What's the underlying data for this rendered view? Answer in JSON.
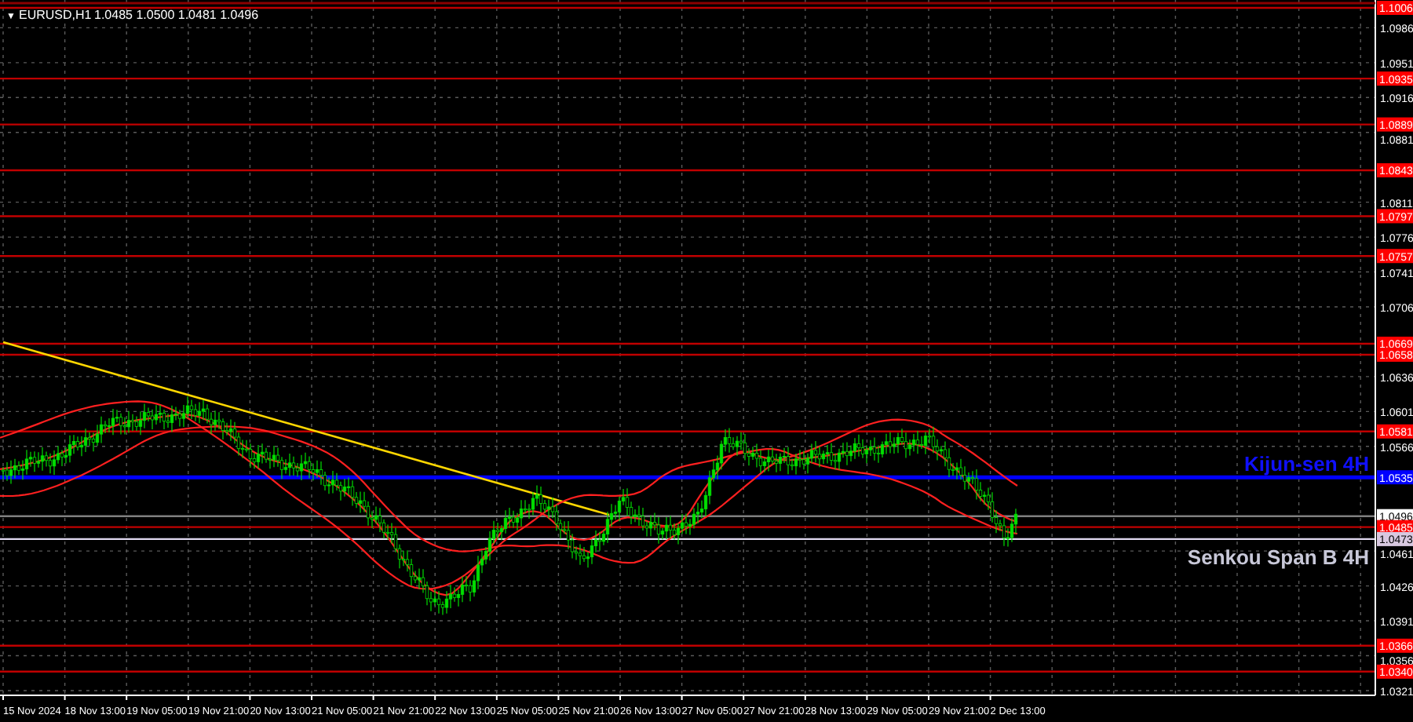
{
  "chart": {
    "marker": "▼",
    "symbol": "EURUSD,H1",
    "ohlc": "1.0485 1.0500 1.0481 1.0496"
  },
  "price_axis": {
    "ticks": [
      "1.0986",
      "1.0951",
      "1.0916",
      "1.0881",
      "1.0811",
      "1.0776",
      "1.0741",
      "1.0706",
      "1.0636",
      "1.0601",
      "1.0566",
      "1.0461",
      "1.0426",
      "1.0391",
      "1.0356",
      "1.0321"
    ]
  },
  "levels": [
    {
      "price": "1.1006",
      "kind": "level"
    },
    {
      "price": "1.0935",
      "kind": "level"
    },
    {
      "price": "1.0889",
      "kind": "level"
    },
    {
      "price": "1.0843",
      "kind": "level"
    },
    {
      "price": "1.0797",
      "kind": "level"
    },
    {
      "price": "1.0757",
      "kind": "level"
    },
    {
      "price": "1.0669",
      "kind": "level"
    },
    {
      "price": "1.0658",
      "kind": "level"
    },
    {
      "price": "1.0581",
      "kind": "level"
    },
    {
      "price": "1.0535",
      "kind": "kijun",
      "caption": "Kijun-sen 4H"
    },
    {
      "price": "1.0496",
      "kind": "current"
    },
    {
      "price": "1.0485",
      "kind": "level"
    },
    {
      "price": "1.0473",
      "kind": "senkou",
      "caption": "Senkou Span B 4H"
    },
    {
      "price": "1.0366",
      "kind": "level"
    },
    {
      "price": "1.0340",
      "kind": "level"
    }
  ],
  "time_axis": {
    "labels": [
      "15 Nov 2024",
      "18 Nov 13:00",
      "19 Nov 05:00",
      "19 Nov 21:00",
      "20 Nov 13:00",
      "21 Nov 05:00",
      "21 Nov 21:00",
      "22 Nov 13:00",
      "25 Nov 05:00",
      "25 Nov 21:00",
      "26 Nov 13:00",
      "27 Nov 05:00",
      "27 Nov 21:00",
      "28 Nov 13:00",
      "29 Nov 05:00",
      "29 Nov 21:00",
      "2 Dec 13:00"
    ]
  }
}
